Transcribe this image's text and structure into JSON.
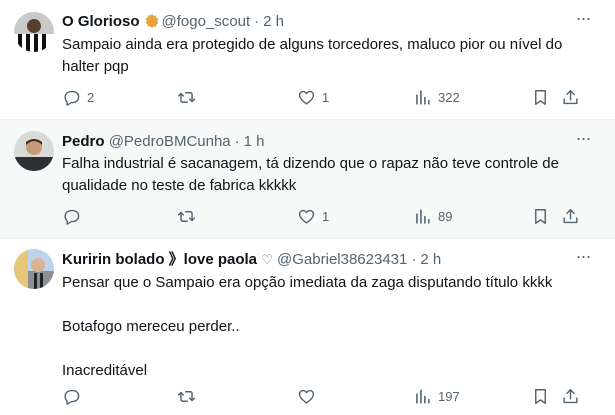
{
  "tweets": [
    {
      "name": "O Glorioso",
      "has_badge": true,
      "handle": "@fogo_scout",
      "dot": "·",
      "time": "2 h",
      "text_lines": [
        "Sampaio ainda era protegido de alguns torcedores, maluco pior ou nível do halter pqp"
      ],
      "replies": "2",
      "retweets": "",
      "likes": "1",
      "views": "322"
    },
    {
      "name": "Pedro",
      "handle": "@PedroBMCunha",
      "dot": "·",
      "time": "1 h",
      "text_lines": [
        "Falha industrial é sacanagem,  tá dizendo que o rapaz não teve controle de qualidade no teste de fabrica kkkkk"
      ],
      "replies": "",
      "retweets": "",
      "likes": "1",
      "views": "89"
    },
    {
      "name": "Kuririn bolado 》love paola",
      "name_suffix": "♡",
      "handle": "@Gabriel38623431",
      "dot": "·",
      "time": "2 h",
      "text_lines": [
        "Pensar que o Sampaio era opção imediata da zaga disputando título kkkk",
        "Botafogo mereceu perder..",
        "Inacreditável"
      ],
      "views": "197"
    }
  ],
  "colors": {
    "text": "#0f1419",
    "muted": "#536471",
    "badge": "#e8a33d",
    "hover_bg": "#f7f9f9"
  },
  "icons": [
    "reply-icon",
    "retweet-icon",
    "like-icon",
    "views-icon",
    "bookmark-icon",
    "share-icon",
    "more-icon",
    "verified-badge-icon"
  ]
}
